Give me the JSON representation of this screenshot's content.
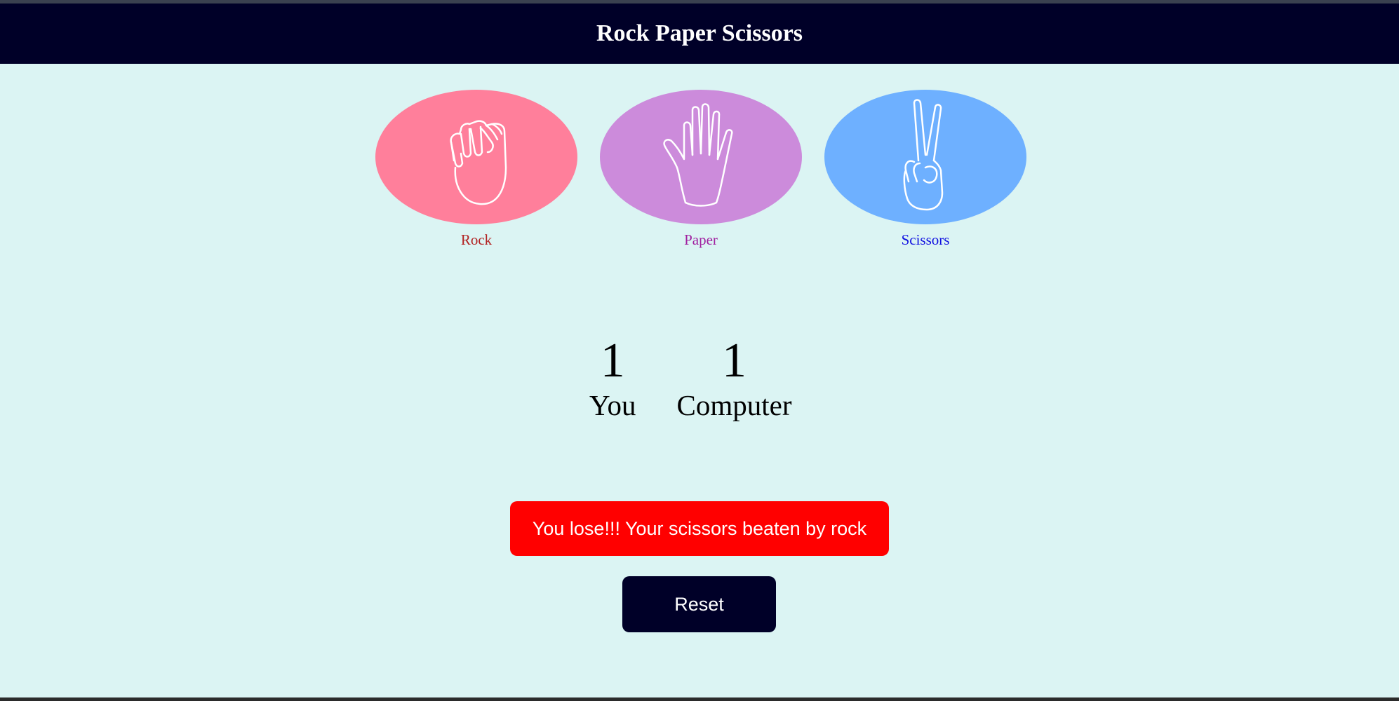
{
  "header": {
    "title": "Rock Paper Scissors"
  },
  "choices": [
    {
      "id": "rock",
      "label": "Rock",
      "icon": "fist-icon",
      "bg": "#ff7f9b",
      "label_color": "#b22222"
    },
    {
      "id": "paper",
      "label": "Paper",
      "icon": "open-hand-icon",
      "bg": "#cc8bdb",
      "label_color": "#a020a0"
    },
    {
      "id": "scissors",
      "label": "Scissors",
      "icon": "peace-hand-icon",
      "bg": "#6eb0ff",
      "label_color": "#1010e0"
    }
  ],
  "scores": {
    "you": {
      "value": "1",
      "label": "You"
    },
    "computer": {
      "value": "1",
      "label": "Computer"
    }
  },
  "message": {
    "text": "You lose!!! Your scissors beaten by rock",
    "bg": "#ff0000"
  },
  "reset": {
    "label": "Reset"
  }
}
